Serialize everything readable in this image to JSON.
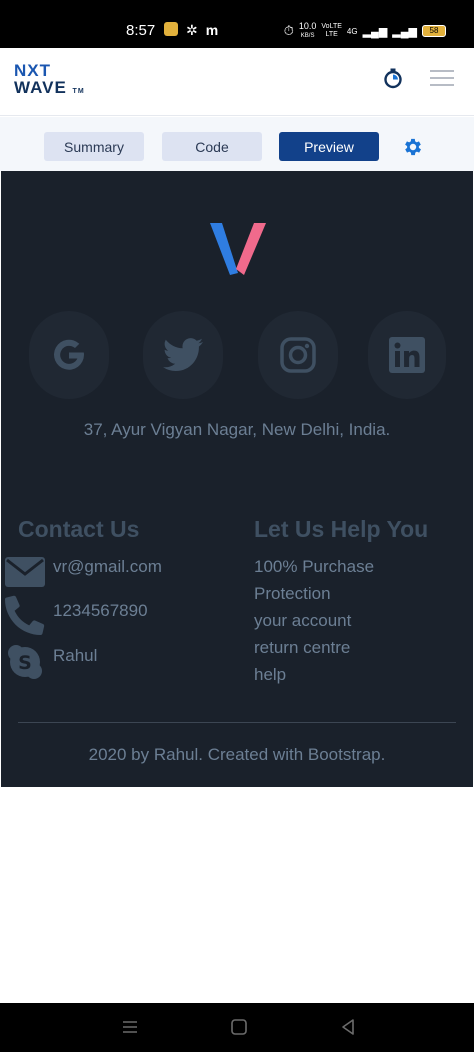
{
  "status_bar": {
    "time": "8:57",
    "left_icons": [
      "notification-icon",
      "pinwheel-icon",
      "m-icon"
    ],
    "net_speed_value": "10.0",
    "net_speed_unit": "KB/S",
    "volte_label": "VoLTE",
    "volte_label2": "LTE",
    "net_type": "4G",
    "battery": "58"
  },
  "header": {
    "logo_line1": "NXT",
    "logo_line2": "WAVE",
    "logo_tm": "TM"
  },
  "tabs": {
    "summary": "Summary",
    "code": "Code",
    "preview": "Preview",
    "active": "preview"
  },
  "preview": {
    "social_icons": [
      "google-icon",
      "twitter-icon",
      "instagram-icon",
      "linkedin-icon"
    ],
    "address": "37, Ayur Vigyan Nagar, New Delhi, India.",
    "contact": {
      "heading": "Contact Us",
      "email": "vr@gmail.com",
      "phone": "1234567890",
      "skype": "Rahul"
    },
    "help": {
      "heading": "Let Us Help You",
      "items": [
        "100% Purchase",
        "Protection",
        "your account",
        "return centre",
        "help"
      ]
    },
    "copyright": "2020 by Rahul. Created with Bootstrap."
  },
  "colors": {
    "preview_bg": "#1a212b",
    "social_circle": "#202833",
    "icon_color": "#3f5062",
    "text_muted": "#6c7f94",
    "active_tab": "#12418a",
    "inactive_tab": "#dde3f2",
    "gear": "#1a73d4"
  }
}
